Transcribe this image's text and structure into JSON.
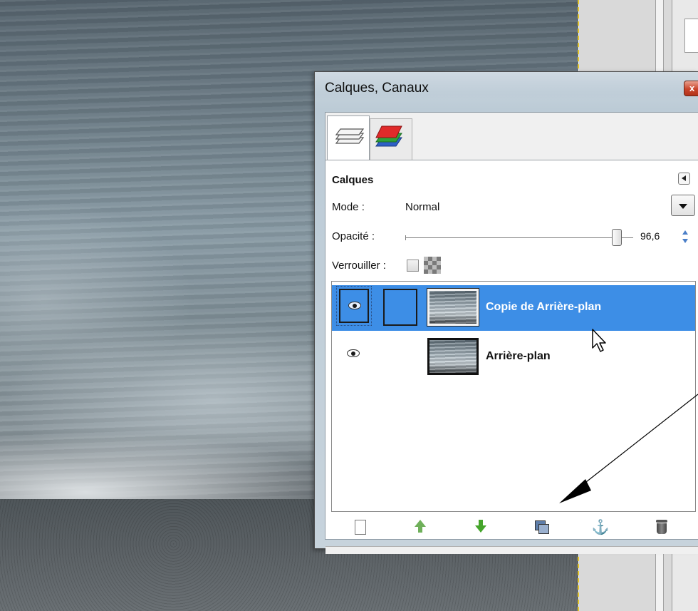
{
  "dialog": {
    "title": "Calques, Canaux",
    "close_label": "x"
  },
  "tabs": [
    {
      "name": "Calques",
      "icon": "layers-icon"
    },
    {
      "name": "Canaux",
      "icon": "channels-icon"
    }
  ],
  "layers_panel": {
    "section_title": "Calques",
    "mode_label": "Mode :",
    "mode_value": "Normal",
    "opacity_label": "Opacité :",
    "opacity_value": "96,6",
    "opacity_fraction": 0.966,
    "lock_label": "Verrouiller :"
  },
  "layers": [
    {
      "name": "Copie de Arrière-plan",
      "selected": true,
      "visible": true
    },
    {
      "name": "Arrière-plan",
      "selected": false,
      "visible": true
    }
  ],
  "buttons": [
    {
      "name": "new-layer",
      "icon": "new-page-icon"
    },
    {
      "name": "raise-layer",
      "icon": "arrow-up-icon"
    },
    {
      "name": "lower-layer",
      "icon": "arrow-down-icon"
    },
    {
      "name": "duplicate-layer",
      "icon": "duplicate-icon"
    },
    {
      "name": "anchor-layer",
      "icon": "anchor-icon"
    },
    {
      "name": "delete-layer",
      "icon": "trash-icon"
    }
  ],
  "colors": {
    "selection": "#3d8ee6",
    "close_button": "#c9442a",
    "guide": "#e5c62a"
  }
}
